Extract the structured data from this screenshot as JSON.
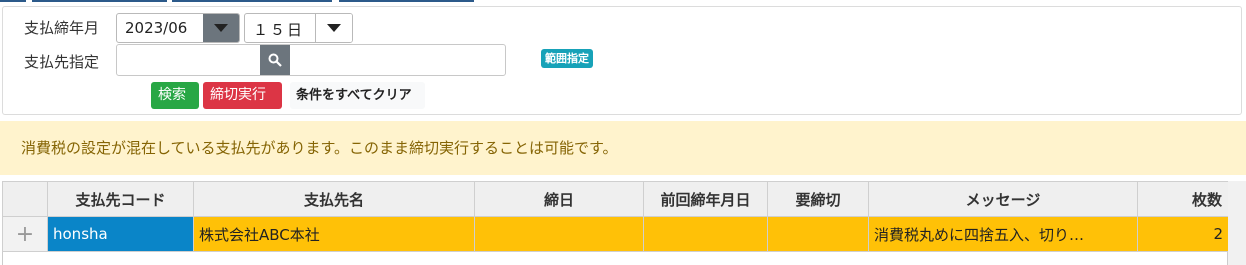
{
  "form": {
    "closing_month_label": "支払締年月",
    "closing_month_value": "2023/06",
    "closing_day_value": "１５日",
    "payee_label": "支払先指定",
    "payee_value": "",
    "range_badge": "範囲指定",
    "search_button": "検索",
    "execute_button": "締切実行",
    "clear_button": "条件をすべてクリア"
  },
  "alert": {
    "message": "消費税の設定が混在している支払先があります。このまま締切実行することは可能です。"
  },
  "grid": {
    "columns": [
      "支払先コード",
      "支払先名",
      "締日",
      "前回締年月日",
      "要締切",
      "メッセージ",
      "枚数"
    ],
    "rows": [
      {
        "expand_symbol": "+",
        "code": "honsha",
        "name": "株式会社ABC本社",
        "closing_day": "",
        "last_closing_date": "",
        "needs_closing": "",
        "message": "消費税丸めに四捨五入、切り…",
        "count": "2"
      }
    ]
  },
  "colors": {
    "alert_bg": "#fff3cd",
    "row_highlight": "#ffc107",
    "selected_cell": "#0a85c8",
    "search_button": "#28a745",
    "execute_button": "#dc3545",
    "range_badge": "#17a2b8"
  },
  "icons": {
    "dropdown": "caret-down-icon",
    "search": "search-icon",
    "expand": "plus-icon"
  }
}
